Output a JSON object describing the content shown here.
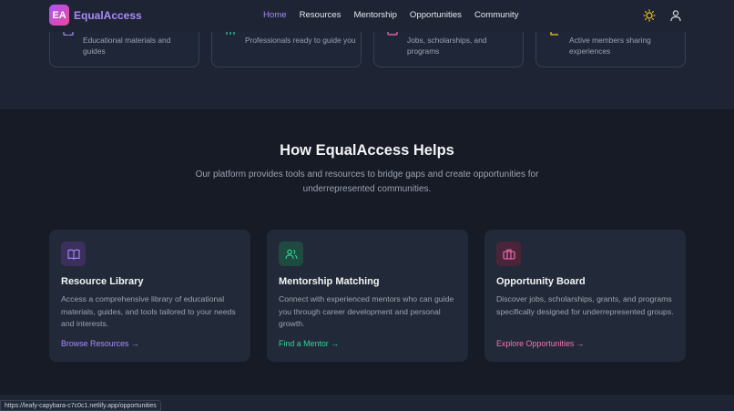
{
  "nav": {
    "logo_badge": "EA",
    "logo_text": "EqualAccess",
    "links": [
      "Home",
      "Resources",
      "Mentorship",
      "Opportunities",
      "Community"
    ]
  },
  "stats": [
    {
      "text": "Educational materials and guides",
      "icon": "book-icon",
      "color": "#a78bfa"
    },
    {
      "text": "Professionals ready to guide you",
      "icon": "users-icon",
      "color": "#34d399"
    },
    {
      "text": "Jobs, scholarships, and programs",
      "icon": "briefcase-icon",
      "color": "#f472b6"
    },
    {
      "text": "Active members sharing experiences",
      "icon": "chat-icon",
      "color": "#facc15"
    }
  ],
  "helps": {
    "title": "How EqualAccess Helps",
    "subtitle": "Our platform provides tools and resources to bridge gaps and create opportunities for underrepresented communities."
  },
  "features": [
    {
      "title": "Resource Library",
      "desc": "Access a comprehensive library of educational materials, guides, and tools tailored to your needs and interests.",
      "link": "Browse Resources →",
      "color": "#a78bfa",
      "icon_bg": "#3b2f5e"
    },
    {
      "title": "Mentorship Matching",
      "desc": "Connect with experienced mentors who can guide you through career development and personal growth.",
      "link": "Find a Mentor →",
      "color": "#34d399",
      "icon_bg": "#1f4a40"
    },
    {
      "title": "Opportunity Board",
      "desc": "Discover jobs, scholarships, grants, and programs specifically designed for underrepresented groups.",
      "link": "Explore Opportunities →",
      "color": "#f472b6",
      "icon_bg": "#4a2438"
    }
  ],
  "status_url": "https://leafy-capybara-c7c0c1.netlify.app/opportunities"
}
